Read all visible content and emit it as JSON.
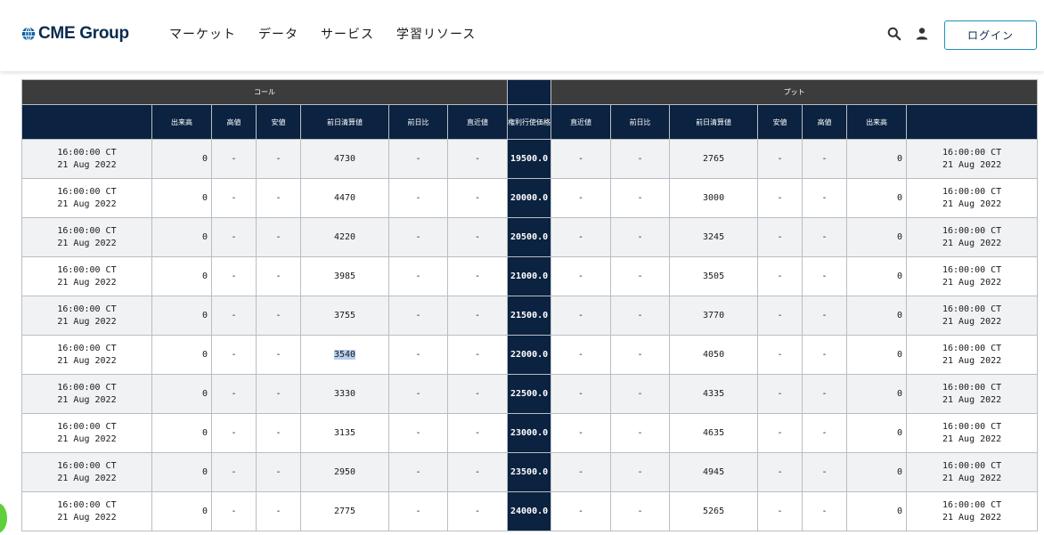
{
  "header": {
    "logo_text": "CME Group",
    "nav": [
      "マーケット",
      "データ",
      "サービス",
      "学習リソース"
    ],
    "login_label": "ログイン",
    "icons": {
      "search": "search-icon",
      "account": "user-icon",
      "logo": "globe-icon"
    },
    "colors": {
      "brand_navy": "#0b2b4e",
      "accent_blue": "#1d91b8",
      "chat_green": "#5fcf3b"
    }
  },
  "table": {
    "calls_label": "コール",
    "puts_label": "プット",
    "call_columns": [
      "出来高",
      "高値",
      "安値",
      "前日清算値",
      "前日比",
      "直近値"
    ],
    "strike_label": "権利行使価格",
    "put_columns": [
      "直近値",
      "前日比",
      "前日清算値",
      "安値",
      "高値",
      "出来高"
    ],
    "rows": [
      {
        "call_time": "16:00:00 CT",
        "call_date": "21 Aug 2022",
        "call_volume": "0",
        "call_high": "-",
        "call_low": "-",
        "call_prior_settle": "4730",
        "call_change": "-",
        "call_last": "-",
        "strike": "19500.0",
        "put_last": "-",
        "put_change": "-",
        "put_prior_settle": "2765",
        "put_low": "-",
        "put_high": "-",
        "put_volume": "0",
        "put_time": "16:00:00 CT",
        "put_date": "21 Aug 2022"
      },
      {
        "call_time": "16:00:00 CT",
        "call_date": "21 Aug 2022",
        "call_volume": "0",
        "call_high": "-",
        "call_low": "-",
        "call_prior_settle": "4470",
        "call_change": "-",
        "call_last": "-",
        "strike": "20000.0",
        "put_last": "-",
        "put_change": "-",
        "put_prior_settle": "3000",
        "put_low": "-",
        "put_high": "-",
        "put_volume": "0",
        "put_time": "16:00:00 CT",
        "put_date": "21 Aug 2022"
      },
      {
        "call_time": "16:00:00 CT",
        "call_date": "21 Aug 2022",
        "call_volume": "0",
        "call_high": "-",
        "call_low": "-",
        "call_prior_settle": "4220",
        "call_change": "-",
        "call_last": "-",
        "strike": "20500.0",
        "put_last": "-",
        "put_change": "-",
        "put_prior_settle": "3245",
        "put_low": "-",
        "put_high": "-",
        "put_volume": "0",
        "put_time": "16:00:00 CT",
        "put_date": "21 Aug 2022"
      },
      {
        "call_time": "16:00:00 CT",
        "call_date": "21 Aug 2022",
        "call_volume": "0",
        "call_high": "-",
        "call_low": "-",
        "call_prior_settle": "3985",
        "call_change": "-",
        "call_last": "-",
        "strike": "21000.0",
        "put_last": "-",
        "put_change": "-",
        "put_prior_settle": "3505",
        "put_low": "-",
        "put_high": "-",
        "put_volume": "0",
        "put_time": "16:00:00 CT",
        "put_date": "21 Aug 2022"
      },
      {
        "call_time": "16:00:00 CT",
        "call_date": "21 Aug 2022",
        "call_volume": "0",
        "call_high": "-",
        "call_low": "-",
        "call_prior_settle": "3755",
        "call_change": "-",
        "call_last": "-",
        "strike": "21500.0",
        "put_last": "-",
        "put_change": "-",
        "put_prior_settle": "3770",
        "put_low": "-",
        "put_high": "-",
        "put_volume": "0",
        "put_time": "16:00:00 CT",
        "put_date": "21 Aug 2022"
      },
      {
        "call_time": "16:00:00 CT",
        "call_date": "21 Aug 2022",
        "call_volume": "0",
        "call_high": "-",
        "call_low": "-",
        "call_prior_settle": "3540",
        "call_change": "-",
        "call_last": "-",
        "strike": "22000.0",
        "put_last": "-",
        "put_change": "-",
        "put_prior_settle": "4050",
        "put_low": "-",
        "put_high": "-",
        "put_volume": "0",
        "put_time": "16:00:00 CT",
        "put_date": "21 Aug 2022",
        "selected": "call_prior_settle"
      },
      {
        "call_time": "16:00:00 CT",
        "call_date": "21 Aug 2022",
        "call_volume": "0",
        "call_high": "-",
        "call_low": "-",
        "call_prior_settle": "3330",
        "call_change": "-",
        "call_last": "-",
        "strike": "22500.0",
        "put_last": "-",
        "put_change": "-",
        "put_prior_settle": "4335",
        "put_low": "-",
        "put_high": "-",
        "put_volume": "0",
        "put_time": "16:00:00 CT",
        "put_date": "21 Aug 2022"
      },
      {
        "call_time": "16:00:00 CT",
        "call_date": "21 Aug 2022",
        "call_volume": "0",
        "call_high": "-",
        "call_low": "-",
        "call_prior_settle": "3135",
        "call_change": "-",
        "call_last": "-",
        "strike": "23000.0",
        "put_last": "-",
        "put_change": "-",
        "put_prior_settle": "4635",
        "put_low": "-",
        "put_high": "-",
        "put_volume": "0",
        "put_time": "16:00:00 CT",
        "put_date": "21 Aug 2022"
      },
      {
        "call_time": "16:00:00 CT",
        "call_date": "21 Aug 2022",
        "call_volume": "0",
        "call_high": "-",
        "call_low": "-",
        "call_prior_settle": "2950",
        "call_change": "-",
        "call_last": "-",
        "strike": "23500.0",
        "put_last": "-",
        "put_change": "-",
        "put_prior_settle": "4945",
        "put_low": "-",
        "put_high": "-",
        "put_volume": "0",
        "put_time": "16:00:00 CT",
        "put_date": "21 Aug 2022"
      },
      {
        "call_time": "16:00:00 CT",
        "call_date": "21 Aug 2022",
        "call_volume": "0",
        "call_high": "-",
        "call_low": "-",
        "call_prior_settle": "2775",
        "call_change": "-",
        "call_last": "-",
        "strike": "24000.0",
        "put_last": "-",
        "put_change": "-",
        "put_prior_settle": "5265",
        "put_low": "-",
        "put_high": "-",
        "put_volume": "0",
        "put_time": "16:00:00 CT",
        "put_date": "21 Aug 2022"
      }
    ]
  },
  "chat_widget": {
    "icon": "chat-icon"
  }
}
